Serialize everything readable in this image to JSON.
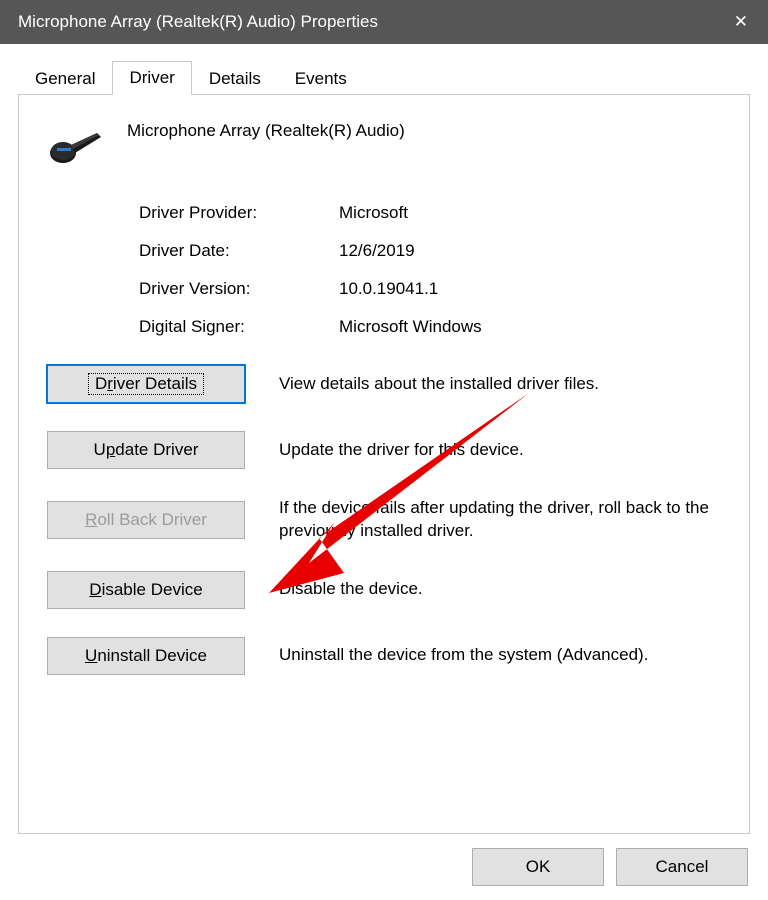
{
  "title": "Microphone Array (Realtek(R) Audio) Properties",
  "tabs": {
    "general": "General",
    "driver": "Driver",
    "details": "Details",
    "events": "Events"
  },
  "device_name": "Microphone Array (Realtek(R) Audio)",
  "info": {
    "provider_label": "Driver Provider:",
    "provider_value": "Microsoft",
    "date_label": "Driver Date:",
    "date_value": "12/6/2019",
    "version_label": "Driver Version:",
    "version_value": "10.0.19041.1",
    "signer_label": "Digital Signer:",
    "signer_value": "Microsoft Windows"
  },
  "actions": {
    "details_btn_pre": "D",
    "details_btn_ul": "r",
    "details_btn_post": "iver Details",
    "details_desc": "View details about the installed driver files.",
    "update_btn_pre": "U",
    "update_btn_ul": "p",
    "update_btn_post": "date Driver",
    "update_desc": "Update the driver for this device.",
    "rollback_btn_pre": "",
    "rollback_btn_ul": "R",
    "rollback_btn_post": "oll Back Driver",
    "rollback_desc": "If the device fails after updating the driver, roll back to the previously installed driver.",
    "disable_btn_pre": "",
    "disable_btn_ul": "D",
    "disable_btn_post": "isable Device",
    "disable_desc": "Disable the device.",
    "uninstall_btn_pre": "",
    "uninstall_btn_ul": "U",
    "uninstall_btn_post": "ninstall Device",
    "uninstall_desc": "Uninstall the device from the system (Advanced)."
  },
  "footer": {
    "ok": "OK",
    "cancel": "Cancel"
  }
}
